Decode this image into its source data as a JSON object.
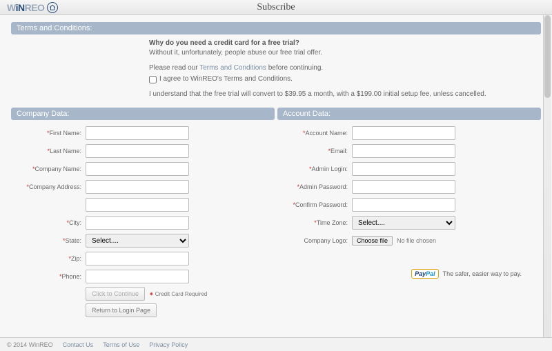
{
  "header": {
    "logo_w": "W",
    "logo_in": "iN",
    "logo_reo": "REO",
    "page_title": "Subscribe"
  },
  "terms": {
    "bar_title": "Terms and Conditions:",
    "question": "Why do you need a credit card for a free trial?",
    "explanation": "Without it, unfortunately, people abuse our free trial offer.",
    "read_prefix": "Please read our ",
    "read_link": "Terms and Conditions",
    "read_suffix": " before continuing.",
    "agree_label": "I agree to WinREO's Terms and Conditions.",
    "understand": "I understand that the free trial will convert to $39.95 a month, with a $199.00 initial setup fee, unless cancelled."
  },
  "company": {
    "bar_title": "Company Data:",
    "first_name_label": "First Name:",
    "last_name_label": "Last Name:",
    "company_name_label": "Company Name:",
    "company_address_label": "Company Address:",
    "city_label": "City:",
    "state_label": "State:",
    "state_placeholder": "Select....",
    "zip_label": "Zip:",
    "phone_label": "Phone:",
    "continue_btn": "Click to Continue",
    "cc_required": "Credit Card Required",
    "return_btn": "Return to Login Page"
  },
  "account": {
    "bar_title": "Account Data:",
    "account_name_label": "Account Name:",
    "email_label": "Email:",
    "admin_login_label": "Admin Login:",
    "admin_password_label": "Admin Password:",
    "confirm_password_label": "Confirm Password:",
    "timezone_label": "Time Zone:",
    "timezone_placeholder": "Select....",
    "logo_label": "Company Logo:",
    "choose_file_btn": "Choose file",
    "no_file_text": "No file chosen",
    "paypal_pay": "Pay",
    "paypal_pal": "Pal",
    "paypal_tagline": "The safer, easier way to pay."
  },
  "footer": {
    "copyright": "© 2014 WinREO",
    "contact": "Contact Us",
    "terms": "Terms of Use",
    "privacy": "Privacy Policy"
  }
}
